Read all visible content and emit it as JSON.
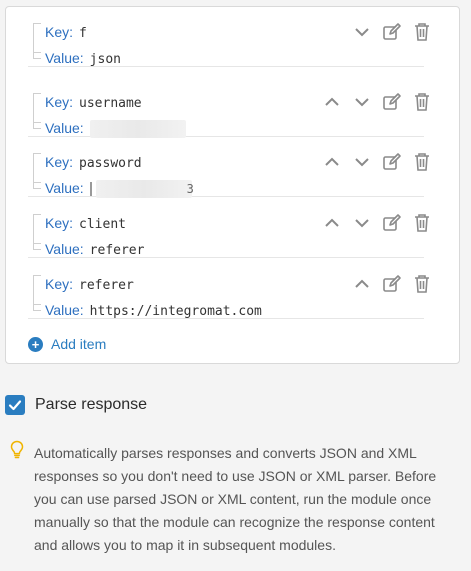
{
  "items": [
    {
      "key_label": "Key:",
      "key": "f",
      "value_label": "Value:",
      "value": "json"
    },
    {
      "key_label": "Key:",
      "key": "username",
      "value_label": "Value:",
      "value": ""
    },
    {
      "key_label": "Key:",
      "key": "password",
      "value_label": "Value:",
      "value": "",
      "value_tail": "3"
    },
    {
      "key_label": "Key:",
      "key": "client",
      "value_label": "Value:",
      "value": "referer"
    },
    {
      "key_label": "Key:",
      "key": "referer",
      "value_label": "Value:",
      "value": "https://integromat.com"
    }
  ],
  "add_item_label": "Add item",
  "parse_response": {
    "label": "Parse response",
    "checked": true
  },
  "help_text": "Automatically parses responses and converts JSON and XML responses so you don't need to use JSON or XML parser. Before you can use parsed JSON or XML content, run the module once manually so that the module can recognize the response content and allows you to map it in subsequent modules.",
  "colors": {
    "accent": "#2a7dc0",
    "label": "#2d6fbf",
    "icon": "#8a8a8a",
    "bulb": "#f0b400"
  },
  "icons": {
    "up": "chevron-up-icon",
    "down": "chevron-down-icon",
    "edit": "edit-icon",
    "delete": "trash-icon",
    "add": "plus-circle-icon",
    "help": "lightbulb-icon"
  }
}
